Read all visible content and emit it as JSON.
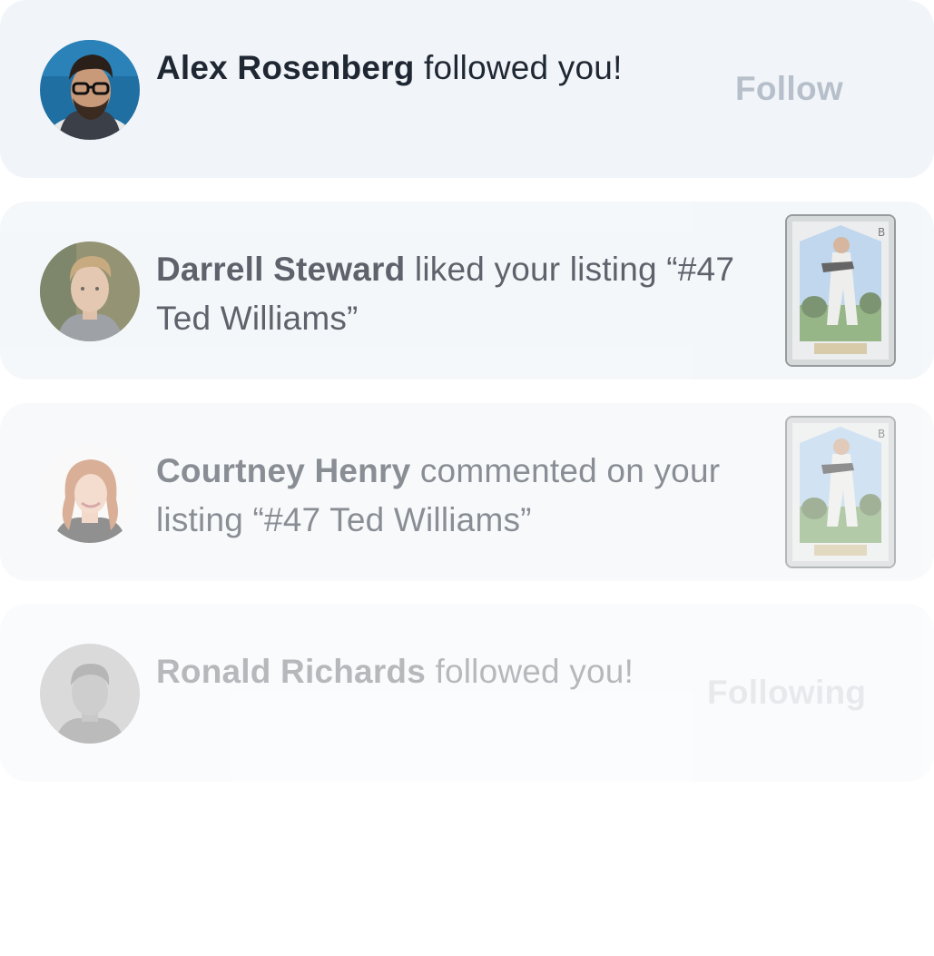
{
  "notifications": [
    {
      "name": "Alex Rosenberg",
      "text": " followed you!",
      "action_label": "Follow",
      "avatar_icon": "avatar-alex-rosenberg"
    },
    {
      "name": "Darrell Steward",
      "text": " liked your listing “#47 Ted Williams”",
      "thumbnail_icon": "baseball-card-ted-williams",
      "avatar_icon": "avatar-darrell-steward"
    },
    {
      "name": "Courtney Henry",
      "text": " commented on your listing “#47 Ted Williams”",
      "thumbnail_icon": "baseball-card-ted-williams",
      "avatar_icon": "avatar-courtney-henry"
    },
    {
      "name": "Ronald Richards",
      "text": " followed you!",
      "action_label": "Following",
      "avatar_icon": "avatar-ronald-richards"
    }
  ],
  "colors": {
    "card_background": "#f1f5f9",
    "text": "#1f2733",
    "action_text": "#b6bfca"
  }
}
